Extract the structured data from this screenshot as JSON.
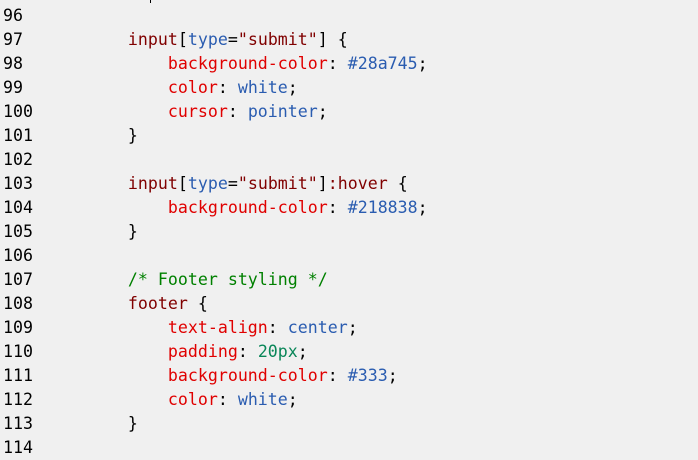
{
  "editor": {
    "lines": [
      {
        "number": "96",
        "tokens": []
      },
      {
        "number": "97",
        "tokens": [
          {
            "t": "sel",
            "v": "        input"
          },
          {
            "t": "punc",
            "v": "["
          },
          {
            "t": "attr",
            "v": "type"
          },
          {
            "t": "punc",
            "v": "="
          },
          {
            "t": "str",
            "v": "\"submit\""
          },
          {
            "t": "punc",
            "v": "] {"
          }
        ]
      },
      {
        "number": "98",
        "tokens": [
          {
            "t": "prop",
            "v": "            background-color"
          },
          {
            "t": "punc",
            "v": ": "
          },
          {
            "t": "val",
            "v": "#28a745"
          },
          {
            "t": "punc",
            "v": ";"
          }
        ]
      },
      {
        "number": "99",
        "tokens": [
          {
            "t": "prop",
            "v": "            color"
          },
          {
            "t": "punc",
            "v": ": "
          },
          {
            "t": "val",
            "v": "white"
          },
          {
            "t": "punc",
            "v": ";"
          }
        ]
      },
      {
        "number": "100",
        "tokens": [
          {
            "t": "prop",
            "v": "            cursor"
          },
          {
            "t": "punc",
            "v": ": "
          },
          {
            "t": "val",
            "v": "pointer"
          },
          {
            "t": "punc",
            "v": ";"
          }
        ]
      },
      {
        "number": "101",
        "tokens": [
          {
            "t": "punc",
            "v": "        }"
          }
        ]
      },
      {
        "number": "102",
        "tokens": []
      },
      {
        "number": "103",
        "tokens": [
          {
            "t": "sel",
            "v": "        input"
          },
          {
            "t": "punc",
            "v": "["
          },
          {
            "t": "attr",
            "v": "type"
          },
          {
            "t": "punc",
            "v": "="
          },
          {
            "t": "str",
            "v": "\"submit\""
          },
          {
            "t": "punc",
            "v": "]"
          },
          {
            "t": "sel",
            "v": ":hover"
          },
          {
            "t": "punc",
            "v": " {"
          }
        ]
      },
      {
        "number": "104",
        "tokens": [
          {
            "t": "prop",
            "v": "            background-color"
          },
          {
            "t": "punc",
            "v": ": "
          },
          {
            "t": "val",
            "v": "#218838"
          },
          {
            "t": "punc",
            "v": ";"
          }
        ]
      },
      {
        "number": "105",
        "tokens": [
          {
            "t": "punc",
            "v": "        }"
          }
        ]
      },
      {
        "number": "106",
        "tokens": []
      },
      {
        "number": "107",
        "tokens": [
          {
            "t": "com",
            "v": "        /* Footer styling */"
          }
        ]
      },
      {
        "number": "108",
        "tokens": [
          {
            "t": "sel",
            "v": "        footer"
          },
          {
            "t": "punc",
            "v": " {"
          }
        ]
      },
      {
        "number": "109",
        "tokens": [
          {
            "t": "prop",
            "v": "            text-align"
          },
          {
            "t": "punc",
            "v": ": "
          },
          {
            "t": "val",
            "v": "center"
          },
          {
            "t": "punc",
            "v": ";"
          }
        ]
      },
      {
        "number": "110",
        "tokens": [
          {
            "t": "prop",
            "v": "            padding"
          },
          {
            "t": "punc",
            "v": ": "
          },
          {
            "t": "num",
            "v": "20px"
          },
          {
            "t": "punc",
            "v": ";"
          }
        ]
      },
      {
        "number": "111",
        "tokens": [
          {
            "t": "prop",
            "v": "            background-color"
          },
          {
            "t": "punc",
            "v": ": "
          },
          {
            "t": "val",
            "v": "#333"
          },
          {
            "t": "punc",
            "v": ";"
          }
        ]
      },
      {
        "number": "112",
        "tokens": [
          {
            "t": "prop",
            "v": "            color"
          },
          {
            "t": "punc",
            "v": ": "
          },
          {
            "t": "val",
            "v": "white"
          },
          {
            "t": "punc",
            "v": ";"
          }
        ]
      },
      {
        "number": "113",
        "tokens": [
          {
            "t": "punc",
            "v": "        }"
          }
        ]
      },
      {
        "number": "114",
        "tokens": []
      }
    ]
  },
  "colors": {
    "background": "#f0f0f0",
    "selector": "#800000",
    "property": "#e00000",
    "value": "#2a5cb0",
    "number": "#098658",
    "comment": "#008000"
  }
}
